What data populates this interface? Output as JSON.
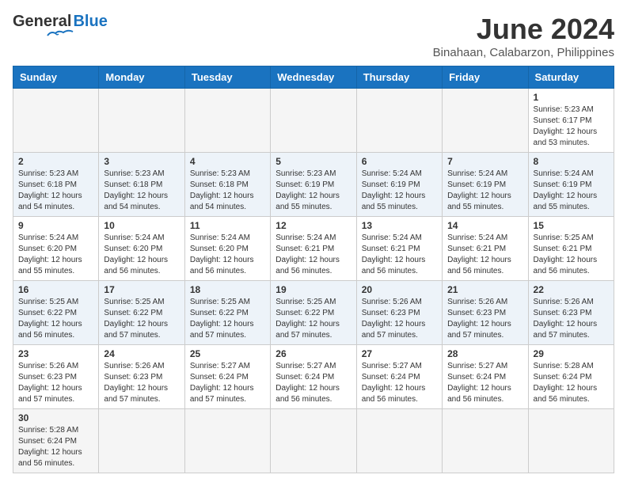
{
  "header": {
    "logo_general": "General",
    "logo_blue": "Blue",
    "title": "June 2024",
    "subtitle": "Binahaan, Calabarzon, Philippines"
  },
  "days_of_week": [
    "Sunday",
    "Monday",
    "Tuesday",
    "Wednesday",
    "Thursday",
    "Friday",
    "Saturday"
  ],
  "weeks": [
    [
      {
        "day": "",
        "info": ""
      },
      {
        "day": "",
        "info": ""
      },
      {
        "day": "",
        "info": ""
      },
      {
        "day": "",
        "info": ""
      },
      {
        "day": "",
        "info": ""
      },
      {
        "day": "",
        "info": ""
      },
      {
        "day": "1",
        "info": "Sunrise: 5:23 AM\nSunset: 6:17 PM\nDaylight: 12 hours\nand 53 minutes."
      }
    ],
    [
      {
        "day": "2",
        "info": "Sunrise: 5:23 AM\nSunset: 6:18 PM\nDaylight: 12 hours\nand 54 minutes."
      },
      {
        "day": "3",
        "info": "Sunrise: 5:23 AM\nSunset: 6:18 PM\nDaylight: 12 hours\nand 54 minutes."
      },
      {
        "day": "4",
        "info": "Sunrise: 5:23 AM\nSunset: 6:18 PM\nDaylight: 12 hours\nand 54 minutes."
      },
      {
        "day": "5",
        "info": "Sunrise: 5:23 AM\nSunset: 6:19 PM\nDaylight: 12 hours\nand 55 minutes."
      },
      {
        "day": "6",
        "info": "Sunrise: 5:24 AM\nSunset: 6:19 PM\nDaylight: 12 hours\nand 55 minutes."
      },
      {
        "day": "7",
        "info": "Sunrise: 5:24 AM\nSunset: 6:19 PM\nDaylight: 12 hours\nand 55 minutes."
      },
      {
        "day": "8",
        "info": "Sunrise: 5:24 AM\nSunset: 6:19 PM\nDaylight: 12 hours\nand 55 minutes."
      }
    ],
    [
      {
        "day": "9",
        "info": "Sunrise: 5:24 AM\nSunset: 6:20 PM\nDaylight: 12 hours\nand 55 minutes."
      },
      {
        "day": "10",
        "info": "Sunrise: 5:24 AM\nSunset: 6:20 PM\nDaylight: 12 hours\nand 56 minutes."
      },
      {
        "day": "11",
        "info": "Sunrise: 5:24 AM\nSunset: 6:20 PM\nDaylight: 12 hours\nand 56 minutes."
      },
      {
        "day": "12",
        "info": "Sunrise: 5:24 AM\nSunset: 6:21 PM\nDaylight: 12 hours\nand 56 minutes."
      },
      {
        "day": "13",
        "info": "Sunrise: 5:24 AM\nSunset: 6:21 PM\nDaylight: 12 hours\nand 56 minutes."
      },
      {
        "day": "14",
        "info": "Sunrise: 5:24 AM\nSunset: 6:21 PM\nDaylight: 12 hours\nand 56 minutes."
      },
      {
        "day": "15",
        "info": "Sunrise: 5:25 AM\nSunset: 6:21 PM\nDaylight: 12 hours\nand 56 minutes."
      }
    ],
    [
      {
        "day": "16",
        "info": "Sunrise: 5:25 AM\nSunset: 6:22 PM\nDaylight: 12 hours\nand 56 minutes."
      },
      {
        "day": "17",
        "info": "Sunrise: 5:25 AM\nSunset: 6:22 PM\nDaylight: 12 hours\nand 57 minutes."
      },
      {
        "day": "18",
        "info": "Sunrise: 5:25 AM\nSunset: 6:22 PM\nDaylight: 12 hours\nand 57 minutes."
      },
      {
        "day": "19",
        "info": "Sunrise: 5:25 AM\nSunset: 6:22 PM\nDaylight: 12 hours\nand 57 minutes."
      },
      {
        "day": "20",
        "info": "Sunrise: 5:26 AM\nSunset: 6:23 PM\nDaylight: 12 hours\nand 57 minutes."
      },
      {
        "day": "21",
        "info": "Sunrise: 5:26 AM\nSunset: 6:23 PM\nDaylight: 12 hours\nand 57 minutes."
      },
      {
        "day": "22",
        "info": "Sunrise: 5:26 AM\nSunset: 6:23 PM\nDaylight: 12 hours\nand 57 minutes."
      }
    ],
    [
      {
        "day": "23",
        "info": "Sunrise: 5:26 AM\nSunset: 6:23 PM\nDaylight: 12 hours\nand 57 minutes."
      },
      {
        "day": "24",
        "info": "Sunrise: 5:26 AM\nSunset: 6:23 PM\nDaylight: 12 hours\nand 57 minutes."
      },
      {
        "day": "25",
        "info": "Sunrise: 5:27 AM\nSunset: 6:24 PM\nDaylight: 12 hours\nand 57 minutes."
      },
      {
        "day": "26",
        "info": "Sunrise: 5:27 AM\nSunset: 6:24 PM\nDaylight: 12 hours\nand 56 minutes."
      },
      {
        "day": "27",
        "info": "Sunrise: 5:27 AM\nSunset: 6:24 PM\nDaylight: 12 hours\nand 56 minutes."
      },
      {
        "day": "28",
        "info": "Sunrise: 5:27 AM\nSunset: 6:24 PM\nDaylight: 12 hours\nand 56 minutes."
      },
      {
        "day": "29",
        "info": "Sunrise: 5:28 AM\nSunset: 6:24 PM\nDaylight: 12 hours\nand 56 minutes."
      }
    ],
    [
      {
        "day": "30",
        "info": "Sunrise: 5:28 AM\nSunset: 6:24 PM\nDaylight: 12 hours\nand 56 minutes."
      },
      {
        "day": "",
        "info": ""
      },
      {
        "day": "",
        "info": ""
      },
      {
        "day": "",
        "info": ""
      },
      {
        "day": "",
        "info": ""
      },
      {
        "day": "",
        "info": ""
      },
      {
        "day": "",
        "info": ""
      }
    ]
  ],
  "colors": {
    "header_bg": "#1a73c0",
    "alt_row": "#f0f4f8",
    "last_row_bg": "#f5f5f5"
  }
}
